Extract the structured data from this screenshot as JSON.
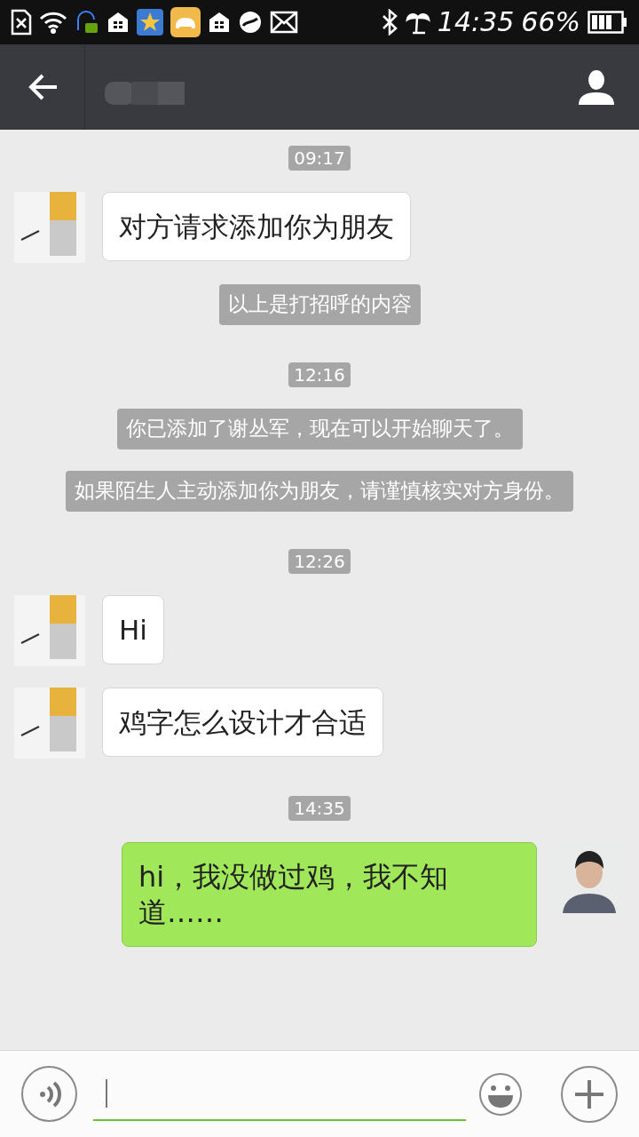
{
  "status_bar": {
    "time": "14:35",
    "battery": "66%"
  },
  "messages": [
    {
      "kind": "time",
      "text": "09:17"
    },
    {
      "kind": "incoming",
      "text": "对方请求添加你为朋友"
    },
    {
      "kind": "system",
      "text": "以上是打招呼的内容"
    },
    {
      "kind": "time",
      "text": "12:16"
    },
    {
      "kind": "system",
      "text": "你已添加了谢丛军，现在可以开始聊天了。"
    },
    {
      "kind": "system",
      "text": "如果陌生人主动添加你为朋友，请谨慎核实对方身份。"
    },
    {
      "kind": "time",
      "text": "12:26"
    },
    {
      "kind": "incoming",
      "text": "Hi"
    },
    {
      "kind": "incoming",
      "text": "鸡字怎么设计才合适"
    },
    {
      "kind": "time",
      "text": "14:35"
    },
    {
      "kind": "outgoing",
      "text": "hi，我没做过鸡，我不知道……"
    }
  ]
}
